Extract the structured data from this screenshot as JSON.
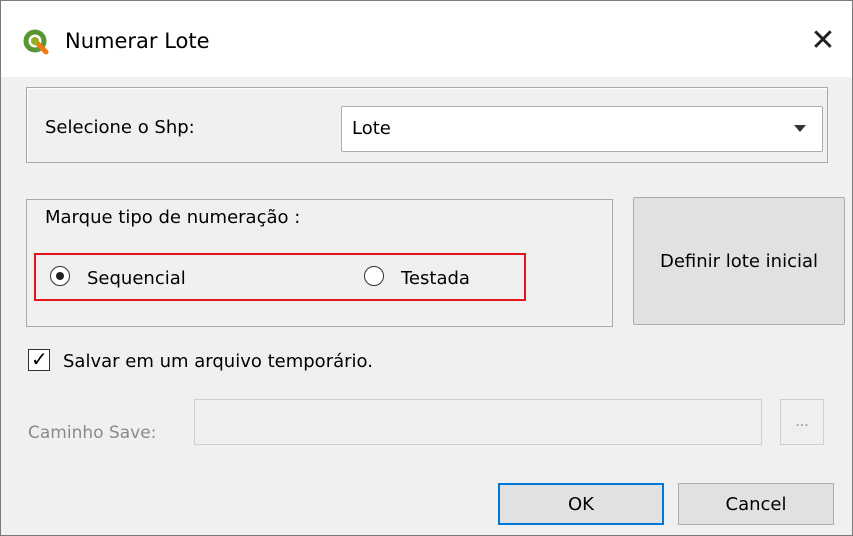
{
  "window": {
    "title": "Numerar Lote",
    "close_glyph": "✕",
    "icon": "qgis-icon"
  },
  "shp": {
    "label": "Selecione o Shp:",
    "selected": "Lote"
  },
  "numbering": {
    "group_label": "Marque tipo de numeração :",
    "options": [
      {
        "label": "Sequencial",
        "checked": true
      },
      {
        "label": "Testada",
        "checked": false
      }
    ]
  },
  "define_button": "Definir lote inicial",
  "temp_file": {
    "label": "Salvar em um arquivo temporário.",
    "checked": true,
    "check_glyph": "✓"
  },
  "save_path": {
    "label": "Caminho Save:",
    "value": "",
    "browse_label": "..."
  },
  "buttons": {
    "ok": "OK",
    "cancel": "Cancel"
  },
  "colors": {
    "highlight": "#e0161b",
    "focus": "#0078d7"
  }
}
